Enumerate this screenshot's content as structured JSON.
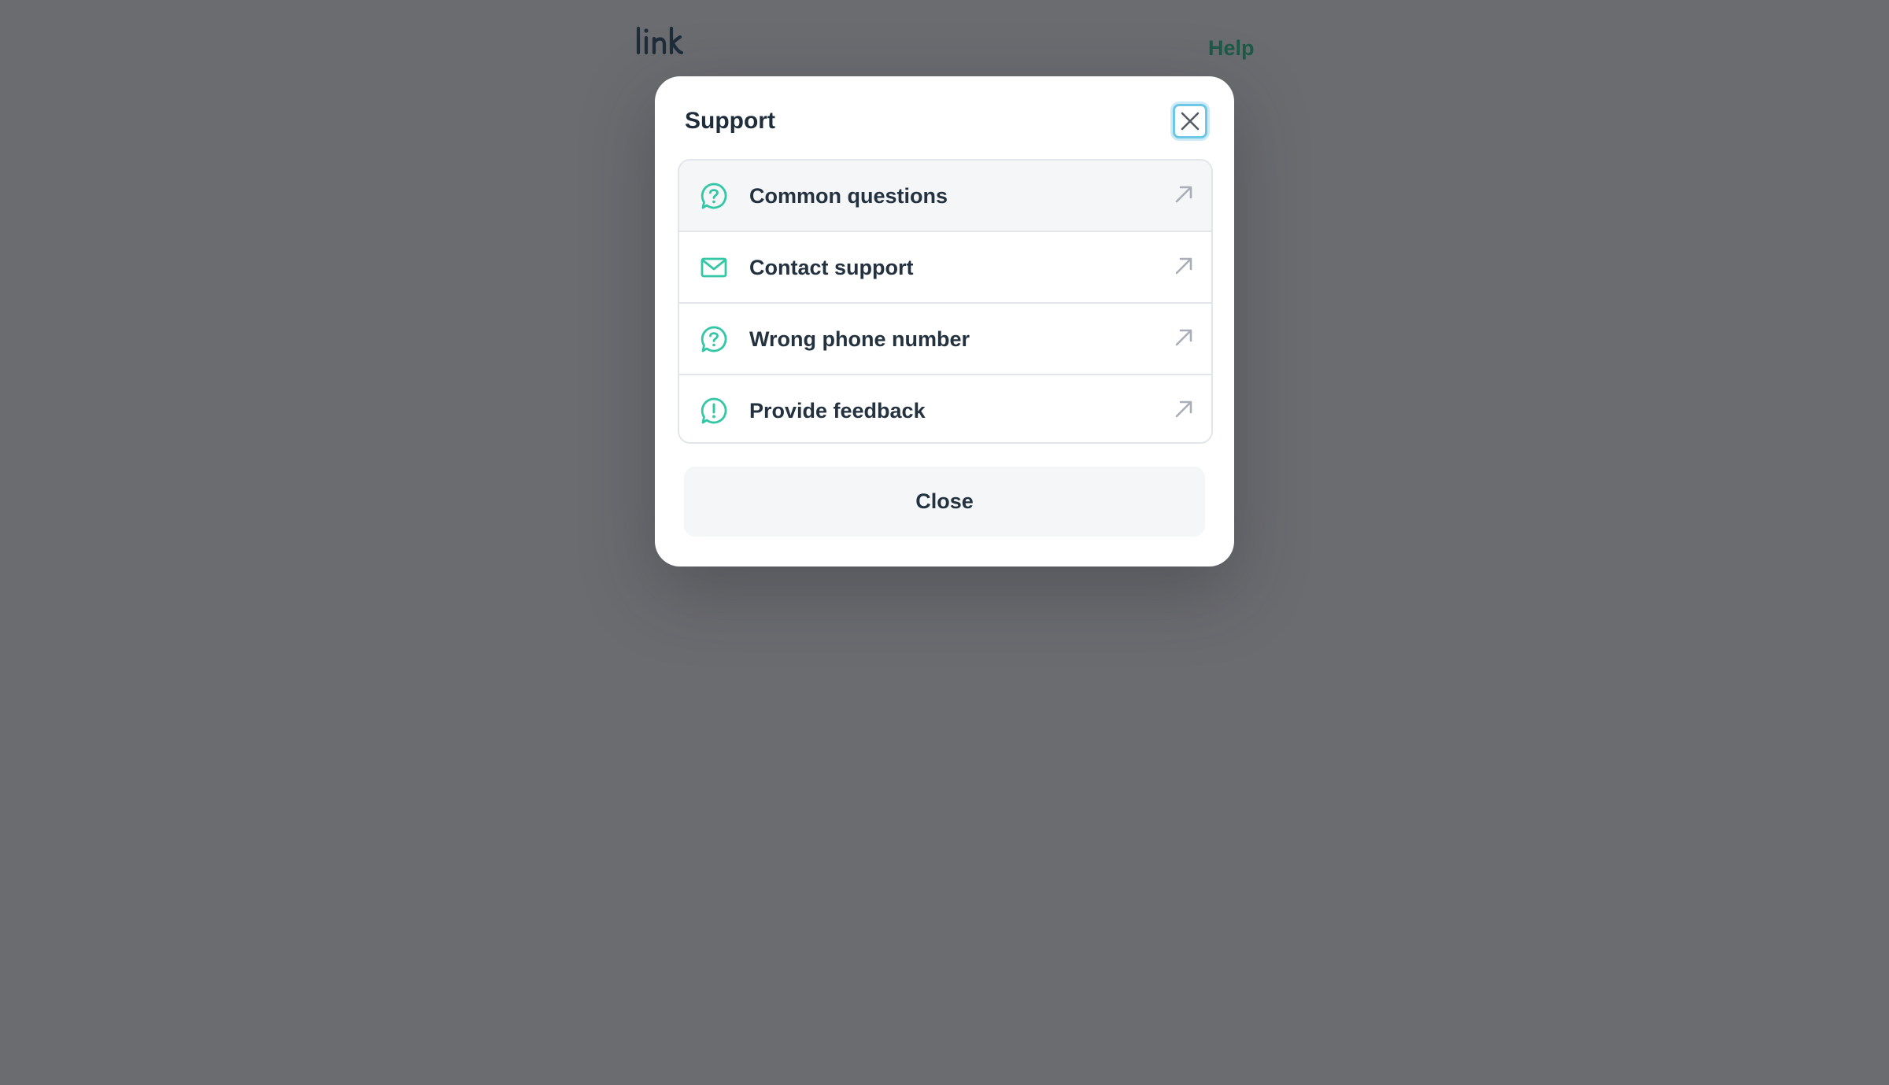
{
  "header": {
    "logo_text": "link",
    "help_label": "Help"
  },
  "modal": {
    "title": "Support",
    "close_icon": "close-icon",
    "options": [
      {
        "label": "Common questions",
        "icon": "question-bubble-icon",
        "trailing_icon": "external-arrow-icon"
      },
      {
        "label": "Contact support",
        "icon": "mail-icon",
        "trailing_icon": "external-arrow-icon"
      },
      {
        "label": "Wrong phone number",
        "icon": "question-bubble-icon",
        "trailing_icon": "external-arrow-icon"
      },
      {
        "label": "Provide feedback",
        "icon": "exclamation-bubble-icon",
        "trailing_icon": "external-arrow-icon"
      }
    ],
    "close_button_label": "Close"
  },
  "colors": {
    "overlay": "#6b6c70",
    "accent": "#33c7a5",
    "help_link": "#1c5a46",
    "text": "#243240",
    "focus_ring": "#6fc7e6"
  }
}
